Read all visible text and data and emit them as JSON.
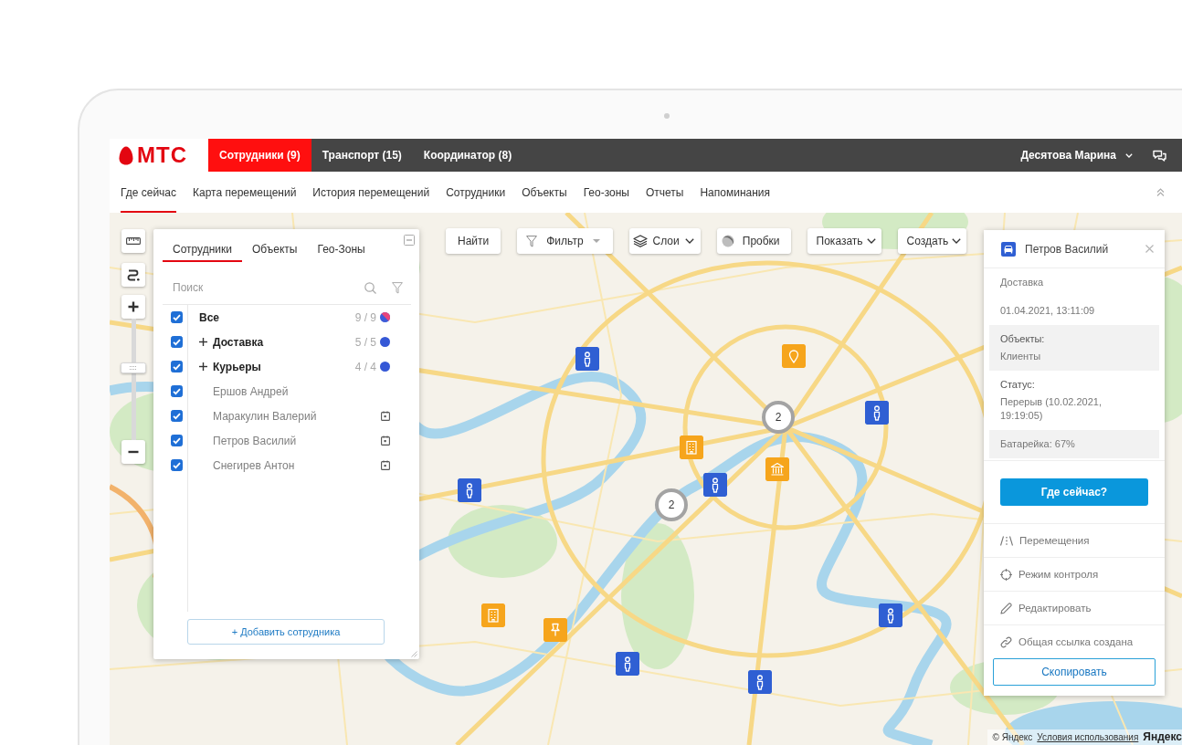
{
  "brand": {
    "name": "МТС"
  },
  "header": {
    "tabs": [
      {
        "label": "Сотрудники (9)",
        "selected": true
      },
      {
        "label": "Транспорт (15)",
        "selected": false
      },
      {
        "label": "Координатор (8)",
        "selected": false
      }
    ],
    "user_name": "Десятова Марина"
  },
  "nav": {
    "items": [
      {
        "label": "Где сейчас",
        "selected": true
      },
      {
        "label": "Карта перемещений",
        "selected": false
      },
      {
        "label": "История перемещений",
        "selected": false
      },
      {
        "label": "Сотрудники",
        "selected": false
      },
      {
        "label": "Объекты",
        "selected": false
      },
      {
        "label": "Гео-зоны",
        "selected": false
      },
      {
        "label": "Отчеты",
        "selected": false
      },
      {
        "label": "Напоминания",
        "selected": false
      }
    ]
  },
  "map_controls": {
    "zoom": {
      "level": 0.6
    }
  },
  "toolbar": {
    "buttons": [
      {
        "label": "Найти",
        "kind": "find"
      },
      {
        "label": "Фильтр",
        "kind": "filter"
      },
      {
        "label": "Слои",
        "kind": "layers"
      },
      {
        "label": "Пробки",
        "kind": "traffic"
      },
      {
        "label": "Показать",
        "kind": "menu"
      },
      {
        "label": "Создать",
        "kind": "menu"
      }
    ]
  },
  "employees_panel": {
    "tabs": [
      {
        "label": "Сотрудники",
        "selected": true
      },
      {
        "label": "Объекты",
        "selected": false
      },
      {
        "label": "Гео-Зоны",
        "selected": false
      }
    ],
    "search": {
      "placeholder": "Поиск"
    },
    "tree": [
      {
        "label": "Все",
        "kind": "all",
        "count": "9 / 9",
        "checked": true,
        "children": [
          {
            "label": "Доставка",
            "kind": "group",
            "count": "5 / 5",
            "color": "#3558d6",
            "checked": true,
            "expanded": false
          },
          {
            "label": "Курьеры",
            "kind": "group",
            "count": "4 / 4",
            "color": "#3558d6",
            "checked": true,
            "expanded": false
          },
          {
            "label": "Ершов Андрей",
            "kind": "person",
            "checked": true,
            "scheduled": false
          },
          {
            "label": "Маракулин Валерий",
            "kind": "person",
            "checked": true,
            "scheduled": true
          },
          {
            "label": "Петров Василий",
            "kind": "person",
            "checked": true,
            "scheduled": true
          },
          {
            "label": "Снегирев Антон",
            "kind": "person",
            "checked": true,
            "scheduled": true
          }
        ]
      }
    ],
    "add_button": "+ Добавить сотрудника"
  },
  "map": {
    "clusters": [
      {
        "count": "2"
      },
      {
        "count": "2"
      }
    ]
  },
  "details_panel": {
    "title": "Петров Василий",
    "rows": [
      {
        "kind": "plain",
        "value": "Доставка"
      },
      {
        "kind": "plain",
        "value": "01.04.2021, 13:11:09"
      },
      {
        "kind": "shaded",
        "label": "Объекты:",
        "value": "Клиенты"
      },
      {
        "kind": "plain",
        "label": "Статус:",
        "value": "Перерыв (10.02.2021, 19:19:05)"
      },
      {
        "kind": "shaded",
        "value": "Батарейка: 67%"
      }
    ],
    "primary_button": "Где сейчас?",
    "actions": [
      {
        "label": "Перемещения",
        "kind": "route"
      },
      {
        "label": "Режим контроля",
        "kind": "target"
      },
      {
        "label": "Редактировать",
        "kind": "edit"
      },
      {
        "label": "Общая ссылка создана",
        "kind": "link"
      }
    ],
    "copy_button": "Скопировать"
  },
  "attribution": {
    "copyright": "© Яндекс",
    "terms": "Условия использования",
    "logo": "Яндекс"
  }
}
